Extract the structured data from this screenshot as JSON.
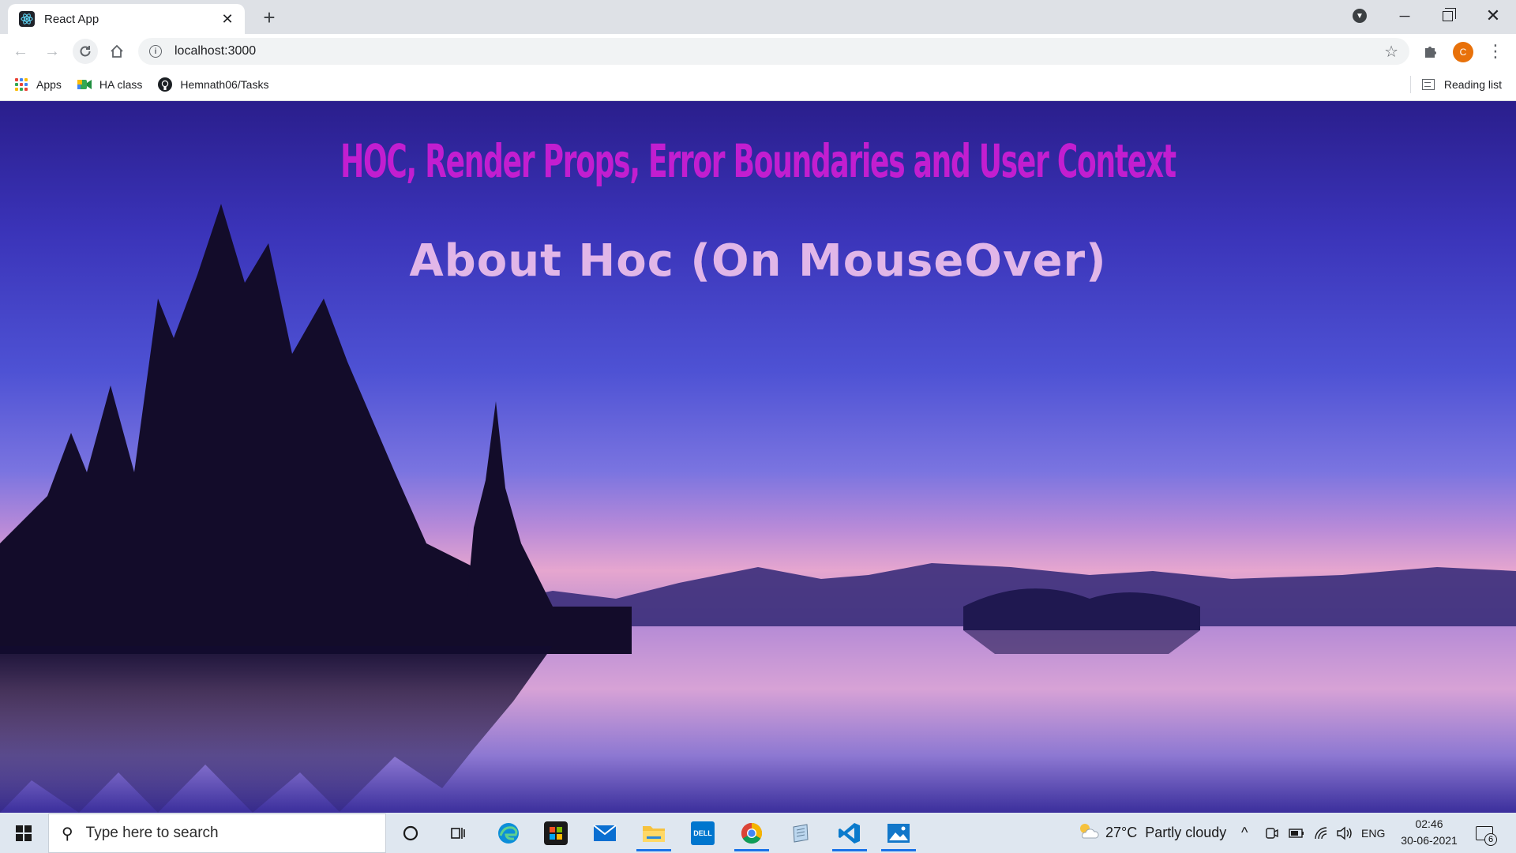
{
  "browser": {
    "tab": {
      "title": "React App",
      "close_symbol": "✕"
    },
    "new_tab_symbol": "+",
    "address_bar": {
      "url": "localhost:3000"
    },
    "profile_initial": "C",
    "bookmarks": [
      {
        "label": "Apps",
        "icon": "apps-grid-icon"
      },
      {
        "label": "HA class",
        "icon": "google-meet-icon"
      },
      {
        "label": "Hemnath06/Tasks",
        "icon": "github-icon"
      }
    ],
    "reading_list_label": "Reading list"
  },
  "page": {
    "title": "HOC, Render Props, Error Boundaries and User Context",
    "subtitle": "About Hoc (On MouseOver)",
    "colors": {
      "title": "#c21ed0",
      "subtitle": "#e1b6e8",
      "sky_top": "#2a1e8c",
      "horizon": "#e6a6cf"
    }
  },
  "taskbar": {
    "search_placeholder": "Type here to search",
    "apps": [
      "cortana-icon",
      "task-view-icon",
      "edge-icon",
      "store-icon",
      "mail-icon",
      "file-explorer-icon",
      "dell-icon",
      "chrome-icon",
      "notepad-icon",
      "vscode-icon",
      "photos-icon"
    ],
    "weather": {
      "temperature": "27°C",
      "condition": "Partly cloudy"
    },
    "language": "ENG",
    "time": "02:46",
    "date": "30-06-2021",
    "notification_count": "6"
  }
}
